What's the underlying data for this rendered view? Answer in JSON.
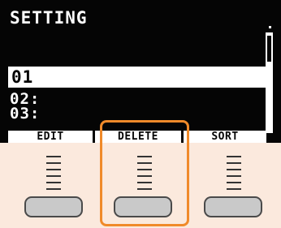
{
  "screen": {
    "title": "SETTING",
    "list": [
      {
        "label": "01",
        "selected": true
      },
      {
        "label": "02:",
        "selected": false
      },
      {
        "label": "03:",
        "selected": false
      }
    ]
  },
  "softkeys": {
    "f1": "EDIT",
    "f2": "DELETE",
    "f3": "SORT"
  },
  "colors": {
    "lcd_background": "#050505",
    "panel_background": "#fbe9dd",
    "highlight": "#f08a2a",
    "button_fill": "#c9c9c9"
  }
}
